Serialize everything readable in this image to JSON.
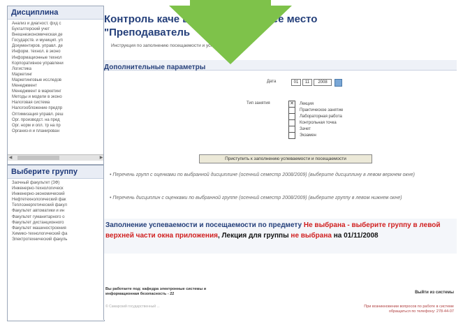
{
  "left": {
    "disciplines_title": "Дисциплина",
    "disciplines": [
      "Анализ и диагност. фхд с",
      "Бухгалтерский учет",
      "Внешнеэкономическая де",
      "Государств. и муницип. уп",
      "Документиров. управл. де",
      "Информ. технол. в эконо",
      "Информационные технол",
      "Корпоративное управлени",
      "Логистика",
      "Маркетинг",
      "Маркетинговые исследов",
      "Менеджмент",
      "Менеджмент в маркетинг",
      "Методы и модели в эконо",
      "Налоговая система",
      "Налогообложение предпр",
      "Оптимизация управл. реш",
      "Орг. производст. на пред",
      "Орг. норм и опл. тр на пр",
      "Организ-я и планирован"
    ],
    "groups_title": "Выберите группу",
    "groups": [
      "Заочный факультет (ЗФ)",
      "Инженерно-технологическ",
      "Инженерно-экономический",
      "Нефтетехнологический фак",
      "Теплоэнергетический факул",
      "Факультет автоматики и ин",
      "Факультет гуманитарного о",
      "Факультет дистанционного",
      "Факультет машиностроения",
      "Химико-технологический фа",
      "Электротехнический факуль"
    ]
  },
  "main": {
    "title_line1": "Контроль каче                 в СамГТУ - рабочее место",
    "title_line2": "\"Преподаватель",
    "instructions_link": "Инструкция по заполнению посещаемости и успеваемости",
    "section_title": "Дополнительные параметры",
    "date_label": "Дата",
    "date_day": "01",
    "date_month": "11",
    "date_year": "2008",
    "type_label": "Тип занятия",
    "options": [
      {
        "label": "Лекция",
        "checked": true
      },
      {
        "label": "Практическое занятие",
        "checked": false
      },
      {
        "label": "Лабораторная работа",
        "checked": false
      },
      {
        "label": "Контрольная точка",
        "checked": false
      },
      {
        "label": "Зачет",
        "checked": false
      },
      {
        "label": "Экзамен",
        "checked": false
      }
    ],
    "start_button": "Приступить к заполнению успеваемости и посещаемости",
    "note1": "• Перечень групп с оценками по выбранной дисциплине (осенний семестр 2008/2009) (выберите дисциплину в левом верхнем окне)",
    "note2": "• Перечень дисциплин с оценками по выбранной группе (осенний семестр 2008/2009) (выберите группу в левом нижнем окне)",
    "fill_part1": "Заполнение успеваемости и посещаемости по предмету ",
    "fill_not_selected": "Не выбрана - выберите группу в левой верхней части окна приложения",
    "fill_part2": ", Лекция для группы ",
    "fill_group_not_selected": "не выбрана",
    "fill_part3": " на 01/11/2008",
    "footer_left1": "Вы работаете под: кафедра электронные системы и",
    "footer_left2": "информационная безопасность - 22",
    "footer_copyright": "© Самарский государственный ...",
    "logout": "Выйти из системы",
    "support_line1": "При возникновении вопросов по работе в системе",
    "support_line2": "обращаться по телефону: 278-44-07"
  },
  "overlay_color": "#7ec24a"
}
